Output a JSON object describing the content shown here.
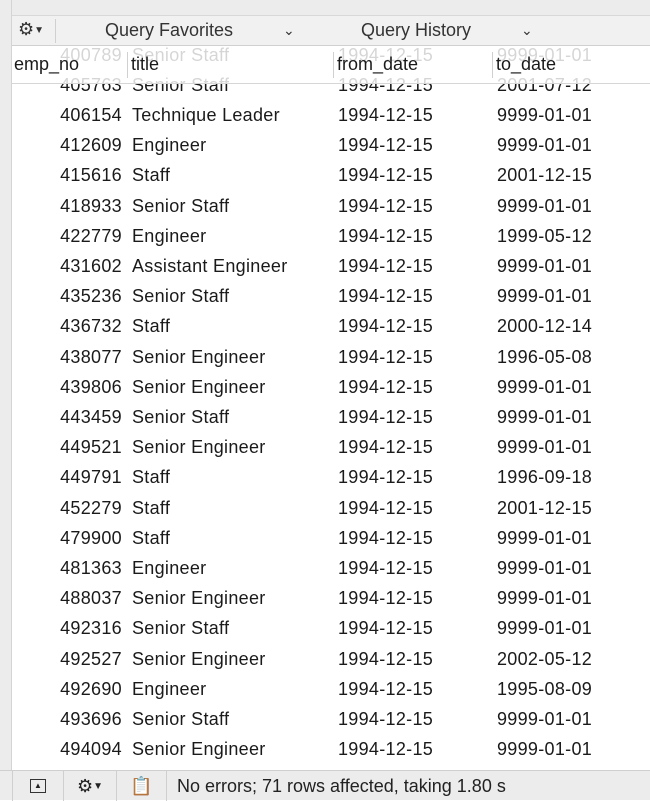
{
  "toolbar": {
    "gear_icon": "gear-icon",
    "favorites": "Query Favorites",
    "history": "Query History"
  },
  "table": {
    "columns": [
      "emp_no",
      "title",
      "from_date",
      "to_date"
    ],
    "rows": [
      [
        "400789",
        "Senior Staff",
        "1994-12-15",
        "9999-01-01"
      ],
      [
        "405763",
        "Senior Staff",
        "1994-12-15",
        "2001-07-12"
      ],
      [
        "406154",
        "Technique Leader",
        "1994-12-15",
        "9999-01-01"
      ],
      [
        "412609",
        "Engineer",
        "1994-12-15",
        "9999-01-01"
      ],
      [
        "415616",
        "Staff",
        "1994-12-15",
        "2001-12-15"
      ],
      [
        "418933",
        "Senior Staff",
        "1994-12-15",
        "9999-01-01"
      ],
      [
        "422779",
        "Engineer",
        "1994-12-15",
        "1999-05-12"
      ],
      [
        "431602",
        "Assistant Engineer",
        "1994-12-15",
        "9999-01-01"
      ],
      [
        "435236",
        "Senior Staff",
        "1994-12-15",
        "9999-01-01"
      ],
      [
        "436732",
        "Staff",
        "1994-12-15",
        "2000-12-14"
      ],
      [
        "438077",
        "Senior Engineer",
        "1994-12-15",
        "1996-05-08"
      ],
      [
        "439806",
        "Senior Engineer",
        "1994-12-15",
        "9999-01-01"
      ],
      [
        "443459",
        "Senior Staff",
        "1994-12-15",
        "9999-01-01"
      ],
      [
        "449521",
        "Senior Engineer",
        "1994-12-15",
        "9999-01-01"
      ],
      [
        "449791",
        "Staff",
        "1994-12-15",
        "1996-09-18"
      ],
      [
        "452279",
        "Staff",
        "1994-12-15",
        "2001-12-15"
      ],
      [
        "479900",
        "Staff",
        "1994-12-15",
        "9999-01-01"
      ],
      [
        "481363",
        "Engineer",
        "1994-12-15",
        "9999-01-01"
      ],
      [
        "488037",
        "Senior Engineer",
        "1994-12-15",
        "9999-01-01"
      ],
      [
        "492316",
        "Senior Staff",
        "1994-12-15",
        "9999-01-01"
      ],
      [
        "492527",
        "Senior Engineer",
        "1994-12-15",
        "2002-05-12"
      ],
      [
        "492690",
        "Engineer",
        "1994-12-15",
        "1995-08-09"
      ],
      [
        "493696",
        "Senior Staff",
        "1994-12-15",
        "9999-01-01"
      ],
      [
        "494094",
        "Senior Engineer",
        "1994-12-15",
        "9999-01-01"
      ]
    ]
  },
  "status": {
    "message": "No errors; 71 rows affected, taking 1.80 s"
  }
}
